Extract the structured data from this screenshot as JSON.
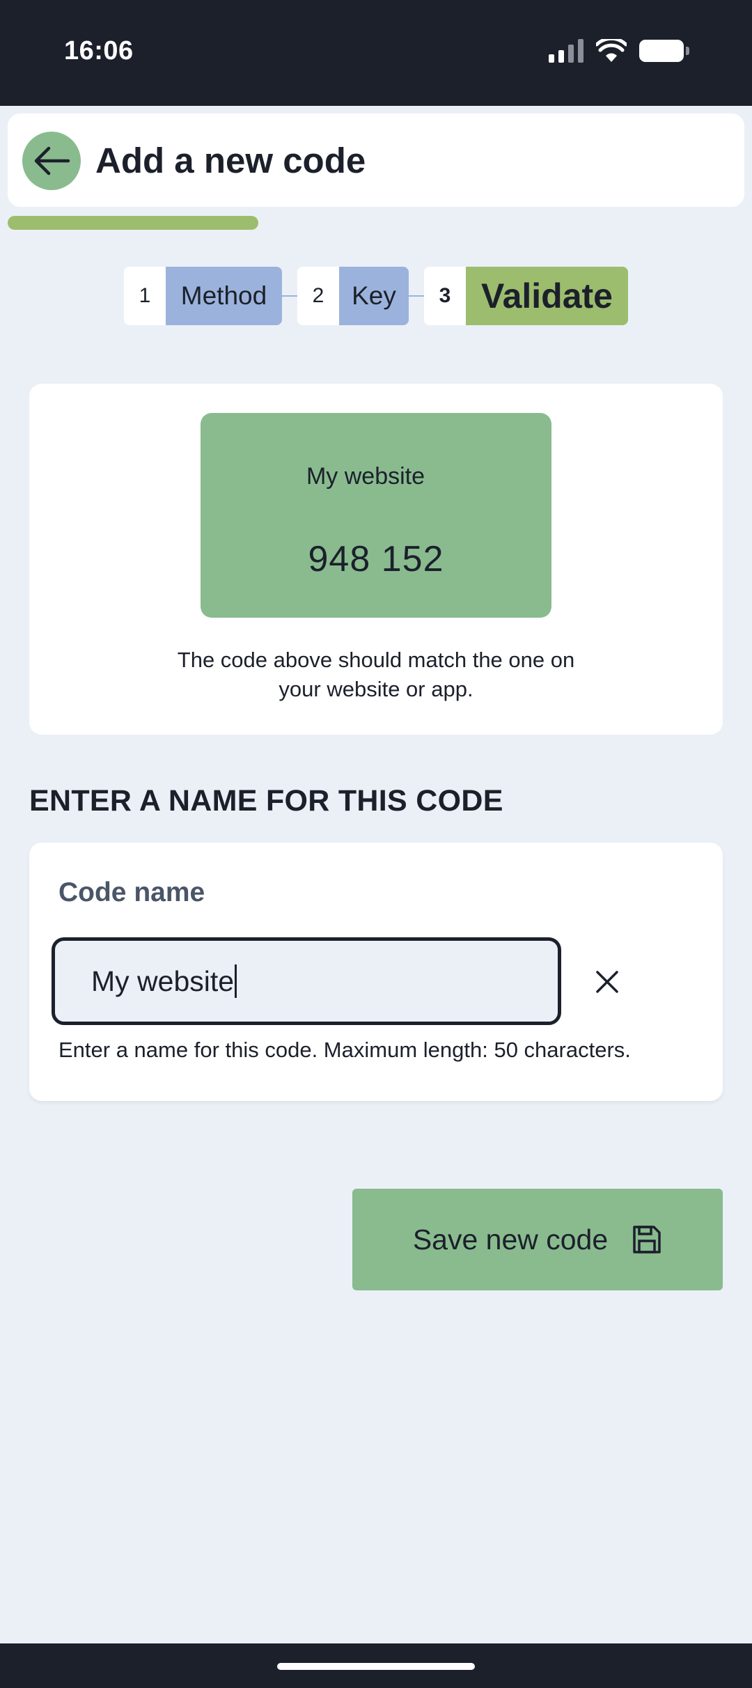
{
  "status_bar": {
    "time": "16:06",
    "icons": [
      "signal-icon",
      "wifi-icon",
      "battery-icon"
    ]
  },
  "header": {
    "title": "Add a new code",
    "back_icon": "arrow-left-icon",
    "progress_fraction": 0.34
  },
  "stepper": {
    "steps": [
      {
        "number": "1",
        "label": "Method",
        "state": "done"
      },
      {
        "number": "2",
        "label": "Key",
        "state": "done"
      },
      {
        "number": "3",
        "label": "Validate",
        "state": "current"
      }
    ]
  },
  "preview": {
    "name": "My website",
    "code": "948 152",
    "hint": "The code above should match the one on your website or app."
  },
  "form": {
    "section_heading": "ENTER A NAME FOR THIS CODE",
    "field_label": "Code name",
    "value": "My website",
    "helper": "Enter a name for this code. Maximum length: 50 characters.",
    "clear_icon": "close-icon"
  },
  "actions": {
    "save_label": "Save new code",
    "save_icon": "floppy-disk-icon"
  },
  "colors": {
    "dark": "#1c202b",
    "background": "#ebf0f7",
    "green": "#89bb8f",
    "lime": "#9dbd6e",
    "blue_step": "#9bb3dc"
  }
}
